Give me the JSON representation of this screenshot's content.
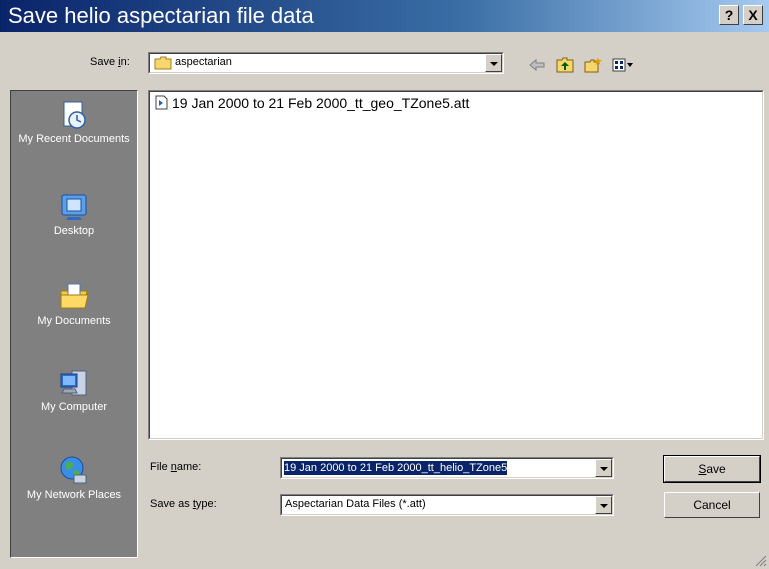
{
  "window": {
    "title": "Save helio aspectarian file data"
  },
  "title_buttons": {
    "help": "?",
    "close": "X"
  },
  "save_in": {
    "label_pre": "Save ",
    "label_key": "i",
    "label_post": "n:",
    "folder": "aspectarian"
  },
  "files": [
    {
      "name": "19 Jan 2000 to 21 Feb 2000_tt_geo_TZone5.att"
    }
  ],
  "places": [
    {
      "label": "My Recent Documents",
      "icon": "recent-documents-icon"
    },
    {
      "label": "Desktop",
      "icon": "desktop-icon"
    },
    {
      "label": "My Documents",
      "icon": "my-documents-icon"
    },
    {
      "label": "My Computer",
      "icon": "my-computer-icon"
    },
    {
      "label": "My Network Places",
      "icon": "network-places-icon"
    }
  ],
  "file_name": {
    "label_pre": "File ",
    "label_key": "n",
    "label_post": "ame:",
    "value": "19 Jan 2000 to 21 Feb 2000_tt_helio_TZone5"
  },
  "save_as_type": {
    "label_pre": "Save as ",
    "label_key": "t",
    "label_post": "ype:",
    "value": "Aspectarian Data Files (*.att)"
  },
  "buttons": {
    "save_key": "S",
    "save_rest": "ave",
    "cancel": "Cancel"
  },
  "colors": {
    "title_start": "#0a246a",
    "title_end": "#a6caf0",
    "face": "#d4d0c8",
    "places_bg": "#808080",
    "selection": "#0a246a"
  }
}
